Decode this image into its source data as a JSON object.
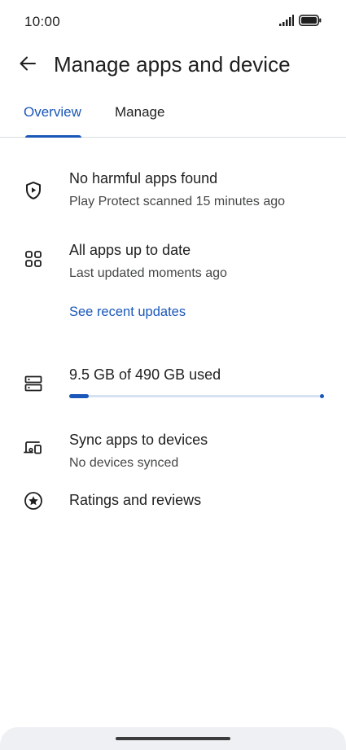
{
  "status_bar": {
    "time": "10:00",
    "icons": [
      "signal-icon",
      "battery-icon"
    ]
  },
  "app_bar": {
    "back_icon": "arrow-back-icon",
    "title": "Manage apps and device"
  },
  "tabs": [
    {
      "label": "Overview",
      "selected": true
    },
    {
      "label": "Manage",
      "selected": false
    }
  ],
  "overview": {
    "protect": {
      "icon": "shield-play-icon",
      "title": "No harmful apps found",
      "subtitle": "Play Protect scanned 15 minutes ago"
    },
    "updates": {
      "icon": "apps-grid-icon",
      "title": "All apps up to date",
      "subtitle": "Last updated moments ago",
      "link": "See recent updates"
    },
    "storage": {
      "icon": "storage-icon",
      "title": "9.5 GB of 490 GB used",
      "used_fraction": 0.019
    },
    "sync": {
      "icon": "devices-icon",
      "title": "Sync apps to devices",
      "subtitle": "No devices synced"
    },
    "ratings": {
      "icon": "star-circle-icon",
      "title": "Ratings and reviews"
    }
  },
  "colors": {
    "accent": "#1a57b8",
    "text_primary": "#1f1f1f",
    "text_secondary": "#444746",
    "divider": "#dadce0"
  }
}
